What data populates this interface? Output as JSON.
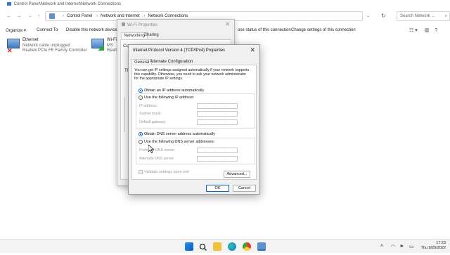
{
  "window": {
    "title": "Control Panel\\Network and Internet\\Network Connections"
  },
  "address": {
    "crumbs": [
      "Control Panel",
      "Network and Internet",
      "Network Connections"
    ],
    "search_placeholder": "Search Network ..."
  },
  "commands": {
    "organize": "Organize ▾",
    "connect_to": "Connect To",
    "disable": "Disable this network device",
    "rename": "ose status of this connection",
    "change_settings": "Change settings of this connection"
  },
  "connections": [
    {
      "name": "Ethernet",
      "status": "Network cable unplugged",
      "device": "Realtek PCIe FE Family Controller"
    },
    {
      "name": "Wi-Fi",
      "status": "MS",
      "device": "Realt"
    }
  ],
  "wifi_dialog": {
    "title": "Wi-Fi Properties",
    "tab_networking": "Networking",
    "tab_sharing": "Sharing",
    "connect_using": "Conne",
    "this_conn": "Th"
  },
  "ipv4_dialog": {
    "title": "Internet Protocol Version 4 (TCP/IPv4) Properties",
    "tab_general": "General",
    "tab_alternate": "Alternate Configuration",
    "description": "You can get IP settings assigned automatically if your network supports this capability. Otherwise, you need to ask your network administrator for the appropriate IP settings.",
    "radio_auto_ip": "Obtain an IP address automatically",
    "radio_manual_ip": "Use the following IP address:",
    "label_ip": "IP address:",
    "label_subnet": "Subnet mask:",
    "label_gateway": "Default gateway:",
    "radio_auto_dns": "Obtain DNS server address automatically",
    "radio_manual_dns": "Use the following DNS server addresses:",
    "label_pref_dns": "Preferred DNS server:",
    "label_alt_dns": "Alternate DNS server:",
    "validate": "Validate settings upon exit",
    "advanced": "Advanced...",
    "ok": "OK",
    "cancel": "Cancel",
    "ip_placeholder": ". . ."
  },
  "taskbar": {
    "time": "17:23",
    "date": "Thu 9/29/2022"
  },
  "icons": [
    "windows-start-icon",
    "search-icon",
    "file-explorer-icon",
    "edge-icon",
    "chrome-icon",
    "control-panel-icon",
    "wifi-icon",
    "volume-icon",
    "notification-icon"
  ]
}
